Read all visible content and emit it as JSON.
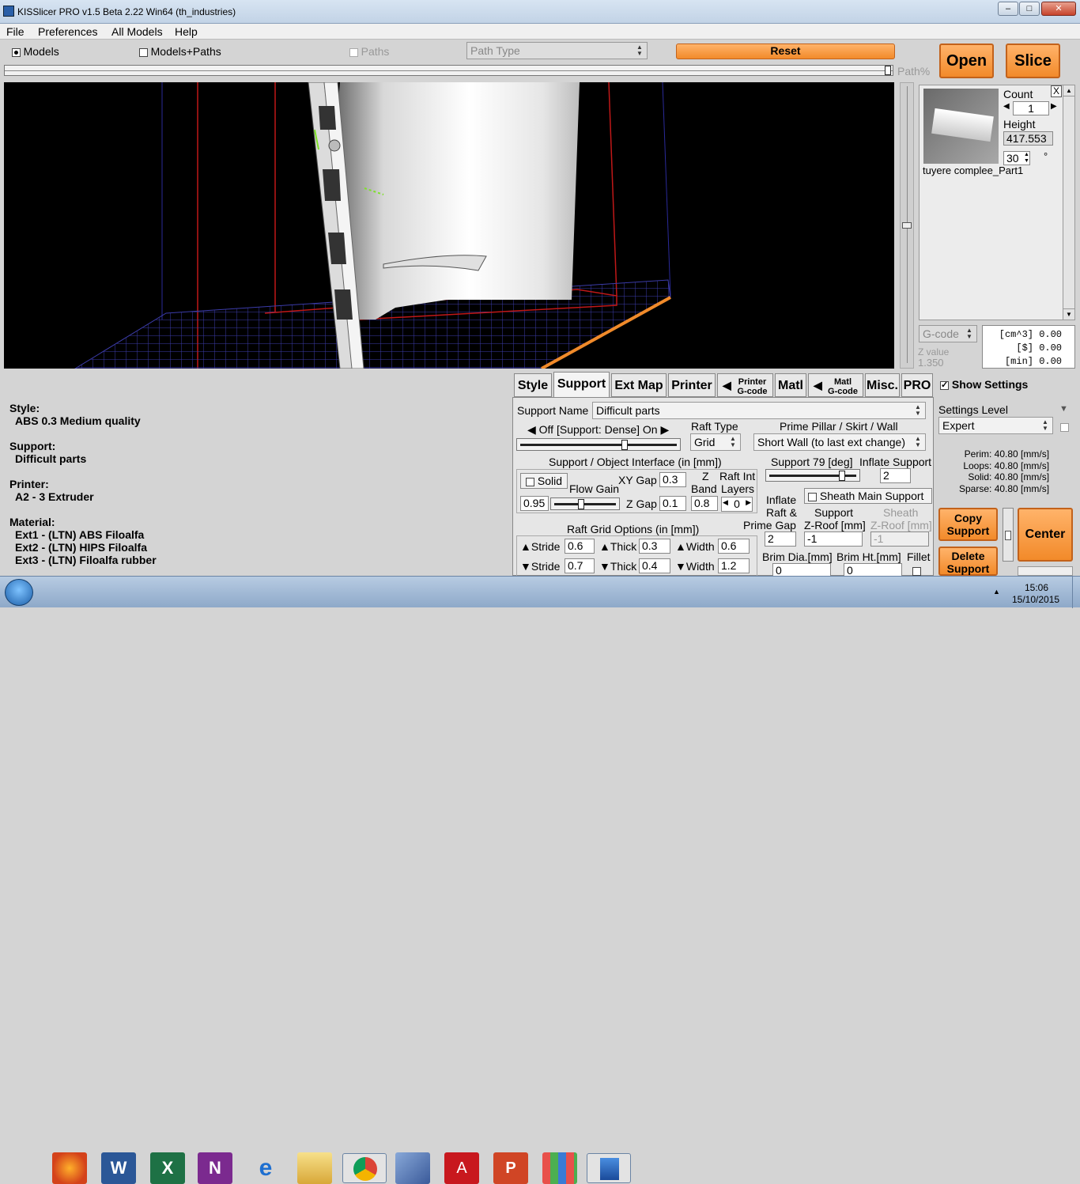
{
  "window": {
    "title": "KISSlicer PRO v1.5 Beta 2.22 Win64 (th_industries)"
  },
  "menu": [
    "File",
    "Preferences",
    "All Models",
    "Help"
  ],
  "view_options": {
    "models": "Models",
    "models_paths": "Models+Paths",
    "paths": "Paths",
    "path_type": "Path Type",
    "reset": "Reset",
    "path_pct": "Path%"
  },
  "actions": {
    "open": "Open",
    "slice": "Slice"
  },
  "model_panel": {
    "count_label": "Count",
    "count_value": "1",
    "height_label": "Height",
    "height_value": "417.553",
    "angle_value": "30",
    "angle_unit": "°",
    "model_name": "tuyere complee_Part1",
    "close": "X"
  },
  "gcode": {
    "select": "G-code",
    "z_value_label": "Z value",
    "z_value": "1.350",
    "stats": [
      "[cm^3]  0.00",
      "[$]  0.00",
      "[min]  0.00"
    ]
  },
  "summary": {
    "style_label": "Style:",
    "style_value": "ABS 0.3 Medium quality",
    "support_label": "Support:",
    "support_value": "Difficult parts",
    "printer_label": "Printer:",
    "printer_value": "A2 - 3 Extruder",
    "material_label": "Material:",
    "materials": [
      "Ext1 - (LTN) ABS Filoalfa",
      "Ext2 - (LTN) HIPS Filoalfa",
      "Ext3 - (LTN) Filoalfa rubber"
    ]
  },
  "tabs": {
    "style": "Style",
    "support": "Support",
    "ext_map": "Ext Map",
    "printer": "Printer",
    "printer_gcode_top": "Printer",
    "printer_gcode_bottom": "G-code",
    "matl": "Matl",
    "matl_gcode_top": "Matl",
    "matl_gcode_bottom": "G-code",
    "misc": "Misc.",
    "pro": "PRO"
  },
  "support_tab": {
    "support_name_label": "Support Name",
    "support_name_value": "Difficult parts",
    "off_on_label": "Off [Support: Dense] On",
    "raft_type_label": "Raft Type",
    "raft_type_value": "Grid",
    "prime_label": "Prime Pillar / Skirt /  Wall",
    "prime_value": "Short Wall (to last ext change)",
    "interface_label": "Support / Object Interface (in [mm])",
    "solid_label": "Solid",
    "flow_gain_label": "Flow Gain",
    "flow_gain_value": "0.95",
    "xy_gap_label": "XY Gap",
    "xy_gap_value": "0.3",
    "z_gap_label": "Z Gap",
    "z_gap_value": "0.1",
    "z_band_label_1": "Z",
    "z_band_label_2": "Band",
    "z_band_value": "0.8",
    "raft_int_label_1": "Raft Int",
    "raft_int_label_2": "Layers",
    "raft_int_value": "0",
    "support_angle_label": "Support 79 [deg]",
    "inflate_support_label": "Inflate Support",
    "inflate_support_value": "2",
    "sheath_main_label": "Sheath Main Support",
    "inflate_raft_label_1": "Inflate",
    "inflate_raft_label_2": "Raft &",
    "inflate_raft_label_3": "Prime Gap",
    "inflate_raft_value": "2",
    "support_zroof_label_1": "Support",
    "support_zroof_label_2": "Z-Roof [mm]",
    "support_zroof_value": "-1",
    "sheath_zroof_label_1": "Sheath",
    "sheath_zroof_label_2": "Z-Roof [mm]",
    "sheath_zroof_value": "-1",
    "raft_grid_label": "Raft Grid Options (in [mm])",
    "stride_label": "Stride",
    "thick_label": "Thick",
    "width_label": "Width",
    "stride_top": "0.6",
    "thick_top": "0.3",
    "width_top": "0.6",
    "stride_bottom": "0.7",
    "thick_bottom": "0.4",
    "width_bottom": "1.2",
    "brim_dia_label": "Brim Dia.[mm]",
    "brim_dia_value": "0",
    "brim_ht_label": "Brim Ht.[mm]",
    "brim_ht_value": "0",
    "fillet_label": "Fillet"
  },
  "right_panel": {
    "show_settings": "Show Settings",
    "settings_level_label": "Settings Level",
    "settings_level_value": "Expert",
    "speeds": [
      "Perim:  40.80 [mm/s]",
      "Loops:  40.80 [mm/s]",
      "Solid:  40.80 [mm/s]",
      "Sparse:  40.80 [mm/s]"
    ],
    "copy_support": "Copy Support",
    "delete_support": "Delete Support",
    "center": "Center"
  },
  "taskbar": {
    "time": "15:06",
    "date": "15/10/2015",
    "icons": [
      "start-orb",
      "firefox",
      "word",
      "excel",
      "onenote",
      "internet-explorer",
      "file-explorer",
      "chrome",
      "app-pen",
      "acrobat",
      "powerpoint",
      "app-grid",
      "kisslicer"
    ]
  }
}
